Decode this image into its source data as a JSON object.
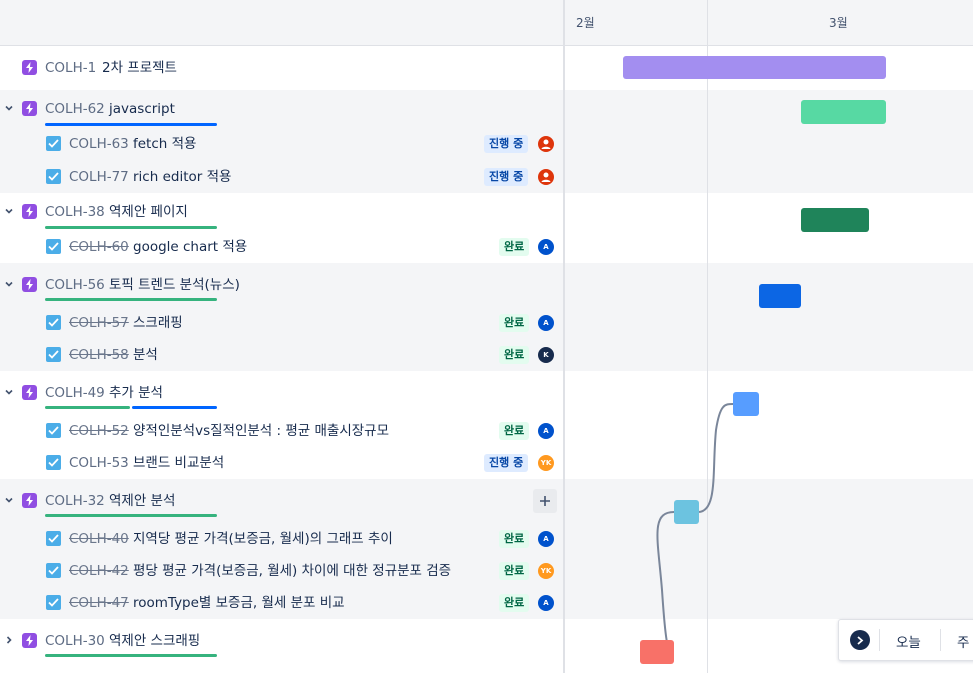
{
  "header": {
    "months": [
      "2월",
      "3월"
    ]
  },
  "rows": [
    {
      "key": "COLH-1",
      "summary": "2차 프로젝트",
      "type": "epic",
      "done": false
    },
    {
      "key": "COLH-62",
      "summary": "javascript",
      "type": "epic",
      "done": false
    },
    {
      "key": "COLH-63",
      "summary": "fetch 적용",
      "type": "task",
      "done": false,
      "status": "진행 중",
      "status_type": "inprogress",
      "avatar": {
        "kind": "person-icon",
        "color": "#de350b"
      }
    },
    {
      "key": "COLH-77",
      "summary": "rich editor 적용",
      "type": "task",
      "done": false,
      "status": "진행 중",
      "status_type": "inprogress",
      "avatar": {
        "kind": "person-icon",
        "color": "#de350b"
      }
    },
    {
      "key": "COLH-38",
      "summary": "역제안 페이지",
      "type": "epic",
      "done": false
    },
    {
      "key": "COLH-60",
      "summary": "google chart 적용",
      "type": "task",
      "done": true,
      "status": "완료",
      "status_type": "done",
      "avatar": {
        "initials": "A",
        "color": "#0052cc"
      }
    },
    {
      "key": "COLH-56",
      "summary": "토픽 트렌드 분석(뉴스)",
      "type": "epic",
      "done": false
    },
    {
      "key": "COLH-57",
      "summary": "스크래핑",
      "type": "task",
      "done": true,
      "status": "완료",
      "status_type": "done",
      "avatar": {
        "initials": "A",
        "color": "#0052cc"
      }
    },
    {
      "key": "COLH-58",
      "summary": "분석",
      "type": "task",
      "done": true,
      "status": "완료",
      "status_type": "done",
      "avatar": {
        "initials": "K",
        "color": "#172b4d"
      }
    },
    {
      "key": "COLH-49",
      "summary": "추가 분석",
      "type": "epic",
      "done": false
    },
    {
      "key": "COLH-52",
      "summary": "양적인분석vs질적인분석 : 평균 매출시장규모",
      "type": "task",
      "done": true,
      "status": "완료",
      "status_type": "done",
      "avatar": {
        "initials": "A",
        "color": "#0052cc"
      }
    },
    {
      "key": "COLH-53",
      "summary": "브랜드 비교분석",
      "type": "task",
      "done": false,
      "status": "진행 중",
      "status_type": "inprogress",
      "avatar": {
        "initials": "YK",
        "color": "#ff991f"
      }
    },
    {
      "key": "COLH-32",
      "summary": "역제안 분석",
      "type": "epic",
      "done": false
    },
    {
      "key": "COLH-40",
      "summary": "지역당 평균 가격(보증금, 월세)의 그래프 추이",
      "type": "task",
      "done": true,
      "status": "완료",
      "status_type": "done",
      "avatar": {
        "initials": "A",
        "color": "#0052cc"
      }
    },
    {
      "key": "COLH-42",
      "summary": "평당 평균 가격(보증금, 월세) 차이에 대한 정규분포 검증",
      "type": "task",
      "done": true,
      "status": "완료",
      "status_type": "done",
      "avatar": {
        "initials": "YK",
        "color": "#ff991f"
      }
    },
    {
      "key": "COLH-47",
      "summary": "roomType별 보증금, 월세 분포 비교",
      "type": "task",
      "done": true,
      "status": "완료",
      "status_type": "done",
      "avatar": {
        "initials": "A",
        "color": "#0052cc"
      }
    },
    {
      "key": "COLH-30",
      "summary": "역제안 스크래핑",
      "type": "epic",
      "done": false
    }
  ],
  "today_panel": {
    "today_label": "오늘",
    "week_label": "주"
  },
  "colors": {
    "epic_icon": "#904ee2",
    "task_icon": "#4bade8",
    "progress_done": "#36b37e",
    "progress_inprogress": "#0065ff",
    "bar_colh1": "#a38ef0",
    "bar_colh62": "#57d9a3",
    "bar_colh38": "#1f845a",
    "bar_colh56": "#0c66e4",
    "bar_colh49": "#579dff",
    "bar_colh32": "#6cc3e0",
    "bar_colh30": "#f87168",
    "dependency_line": "#7a869a"
  }
}
